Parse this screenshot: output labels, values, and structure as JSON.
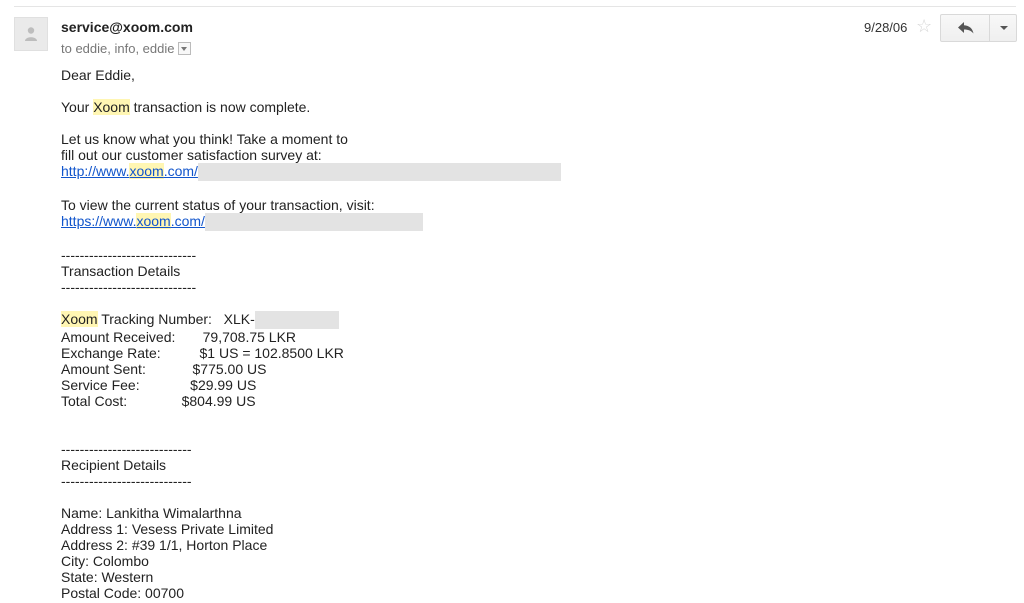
{
  "header": {
    "sender": "service@xoom.com",
    "recipients": "to eddie, info, eddie",
    "date": "9/28/06"
  },
  "body": {
    "greeting": "Dear Eddie,",
    "line_complete_prefix": "Your ",
    "brand": "Xoom",
    "line_complete_suffix": " transaction is now complete.",
    "survey_line1": "Let us know what you think!  Take a moment to",
    "survey_line2": "fill out our customer satisfaction survey at:",
    "survey_link_prefix": "http://www.",
    "link_domain": "xoom",
    "survey_link_suffix": ".com/",
    "status_line": "To view the current status of your transaction, visit:",
    "status_link_prefix": "https://www.",
    "status_link_suffix": ".com/",
    "divider1": "-----------------------------",
    "transaction_heading": "Transaction Details",
    "tracking_label_suffix": " Tracking Number:   XLK-",
    "amount_received": "Amount Received:       79,708.75 LKR",
    "exchange_rate": "Exchange Rate:          $1 US = 102.8500 LKR",
    "amount_sent": "Amount Sent:            $775.00 US",
    "service_fee": "Service Fee:             $29.99 US",
    "total_cost": "Total Cost:              $804.99 US",
    "divider2": "----------------------------",
    "recipient_heading": "Recipient Details",
    "name": "Name: Lankitha Wimalarthna",
    "address1": "Address 1: Vesess Private Limited",
    "address2": "Address 2: #39 1/1, Horton Place",
    "city": "City: Colombo",
    "state": "State: Western",
    "postal": "Postal Code: 00700"
  },
  "icons": {
    "avatar": "person-icon",
    "star": "star-icon",
    "reply": "reply-arrow-icon",
    "more": "chevron-down-icon"
  },
  "colors": {
    "link": "#1155cc",
    "highlight": "#fff6b3",
    "redaction": "#e3e3e3"
  }
}
